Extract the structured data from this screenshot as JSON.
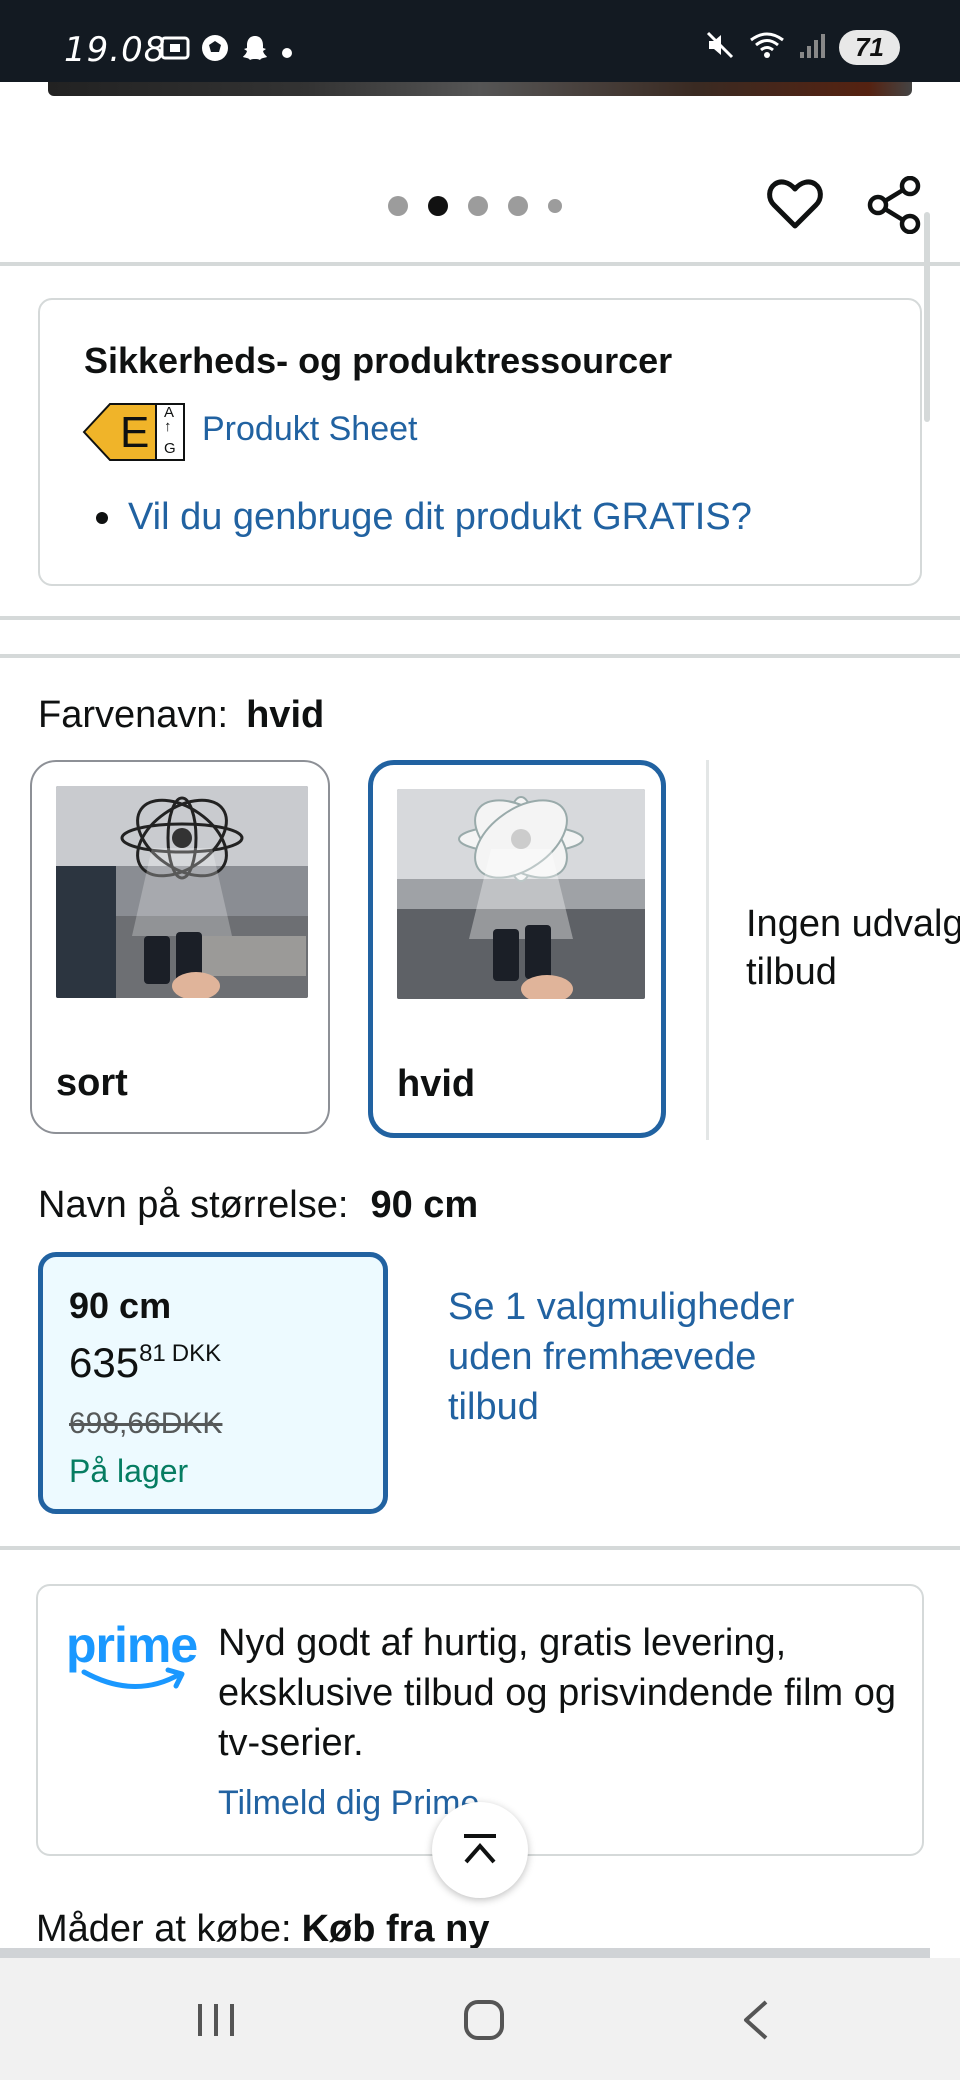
{
  "status_bar": {
    "time": "19.08",
    "battery": "71",
    "left_icons": [
      "screenshot-icon",
      "football-icon",
      "snapchat-icon",
      "dot-icon"
    ],
    "right_icons": [
      "mute-icon",
      "wifi-icon",
      "signal-icon"
    ]
  },
  "carousel": {
    "dot_count": 5,
    "active_index": 1
  },
  "safety": {
    "title": "Sikkerheds- og produktressourcer",
    "energy_class": "E",
    "energy_scale_top": "A",
    "energy_scale_bottom": "G",
    "produkt_sheet": "Produkt Sheet",
    "recycle_link": "Vil du genbruge dit produkt GRATIS?"
  },
  "color": {
    "label": "Farvenavn:",
    "selected": "hvid",
    "options": [
      {
        "name": "sort"
      },
      {
        "name": "hvid"
      }
    ],
    "no_offer_text_line1": "Ingen udvalgte",
    "no_offer_text_line2": "tilbud"
  },
  "size": {
    "label": "Navn på størrelse:",
    "selected": "90 cm",
    "option": {
      "name": "90 cm",
      "price_whole": "635",
      "price_fraction": "81",
      "currency": "DKK",
      "old_price": "698,66DKK",
      "stock": "På lager"
    },
    "see_options": "Se 1 valgmuligheder uden fremhævede tilbud"
  },
  "prime": {
    "logo_text": "prime",
    "text": "Nyd godt af hurtig, gratis levering, eksklusive tilbud og prisvindende film og tv-serier.",
    "link": "Tilmeld dig Prime"
  },
  "buy_ways": {
    "label": "Måder at købe:",
    "value": "Køb fra ny"
  },
  "colors": {
    "link": "#2162a1",
    "selected_border": "#2162a1",
    "in_stock": "#067d62",
    "energy_E": "#f0b429",
    "prime_blue": "#1a98ff"
  }
}
